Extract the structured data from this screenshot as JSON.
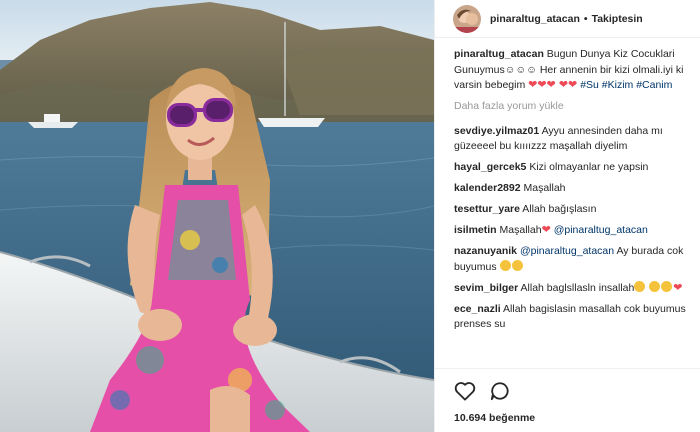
{
  "header": {
    "username": "pinaraltug_atacan",
    "separator": "•",
    "follow_status": "Takiptesin"
  },
  "caption": {
    "username": "pinaraltug_atacan",
    "text": "Bugun Dunya Kiz Cocuklari Gunuymus☺☺☺ Her annenin bir kizi olmali.iyi ki varsin bebegim",
    "hearts": "❤❤❤ ❤❤",
    "hashtags": "#Su #Kizim #Canim"
  },
  "load_more": "Daha fazla yorum yükle",
  "comments": [
    {
      "username": "sevdiye.yilmaz01",
      "text": "Ayyu annesinden daha mı güzeeeel bu kıııızzz maşallah diyelim"
    },
    {
      "username": "hayal_gercek5",
      "text": "Kizi olmayanlar ne yapsin"
    },
    {
      "username": "kalender2892",
      "text": "Maşallah"
    },
    {
      "username": "tesettur_yare",
      "text": "Allah bağışlasın"
    },
    {
      "username": "isilmetin",
      "text": "Maşallah",
      "heart": "❤",
      "mention": "@pinaraltug_atacan"
    },
    {
      "username": "nazanuyanik",
      "mention": "@pinaraltug_atacan",
      "text": "Ay burada cok buyumus"
    },
    {
      "username": "sevim_bilger",
      "text": "Allah baglsllasln insallah",
      "heart": "❤"
    },
    {
      "username": "ece_nazli",
      "text": "Allah bagislasin masallah cok buyumus prenses su"
    }
  ],
  "likes": "10.694 beğenme",
  "icons": [
    "heart-outline-icon",
    "comment-bubble-icon"
  ],
  "colors": {
    "link": "#003569",
    "heart": "#ed4956",
    "muted": "#999999"
  }
}
